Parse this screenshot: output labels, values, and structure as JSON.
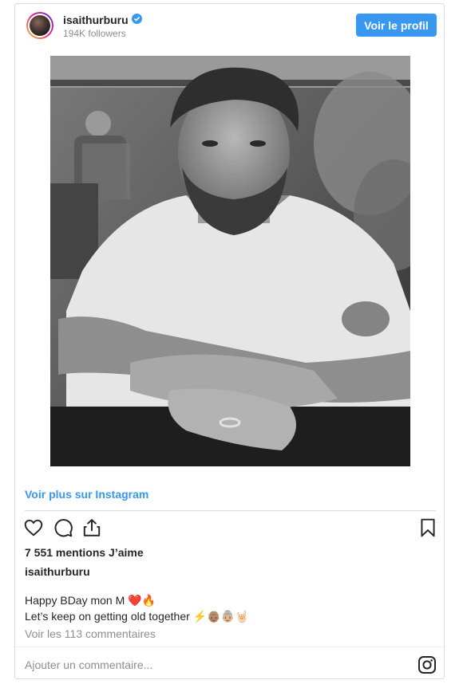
{
  "header": {
    "username": "isaithurburu",
    "followers": "194K followers",
    "profile_button": "Voir le profil"
  },
  "post": {
    "image_icon": "black-and-white-portrait-photo",
    "more_link": "Voir plus sur Instagram",
    "likes": "7 551 mentions J’aime",
    "author": "isaithurburu",
    "caption_line1": "Happy BDay mon M ❤️🔥",
    "caption_line2": "Let’s keep on getting old together ⚡👴🏽👵🏼🤘🏻",
    "comments_link": "Voir les 113 commentaires",
    "comment_placeholder": "Ajouter un commentaire..."
  },
  "icons": {
    "like": "heart-icon",
    "comment": "comment-icon",
    "share": "share-icon",
    "save": "bookmark-icon",
    "logo": "instagram-icon"
  },
  "colors": {
    "accent": "#3897f0",
    "text": "#262626",
    "muted": "#8e8e8e",
    "border": "#dbdbdb"
  }
}
